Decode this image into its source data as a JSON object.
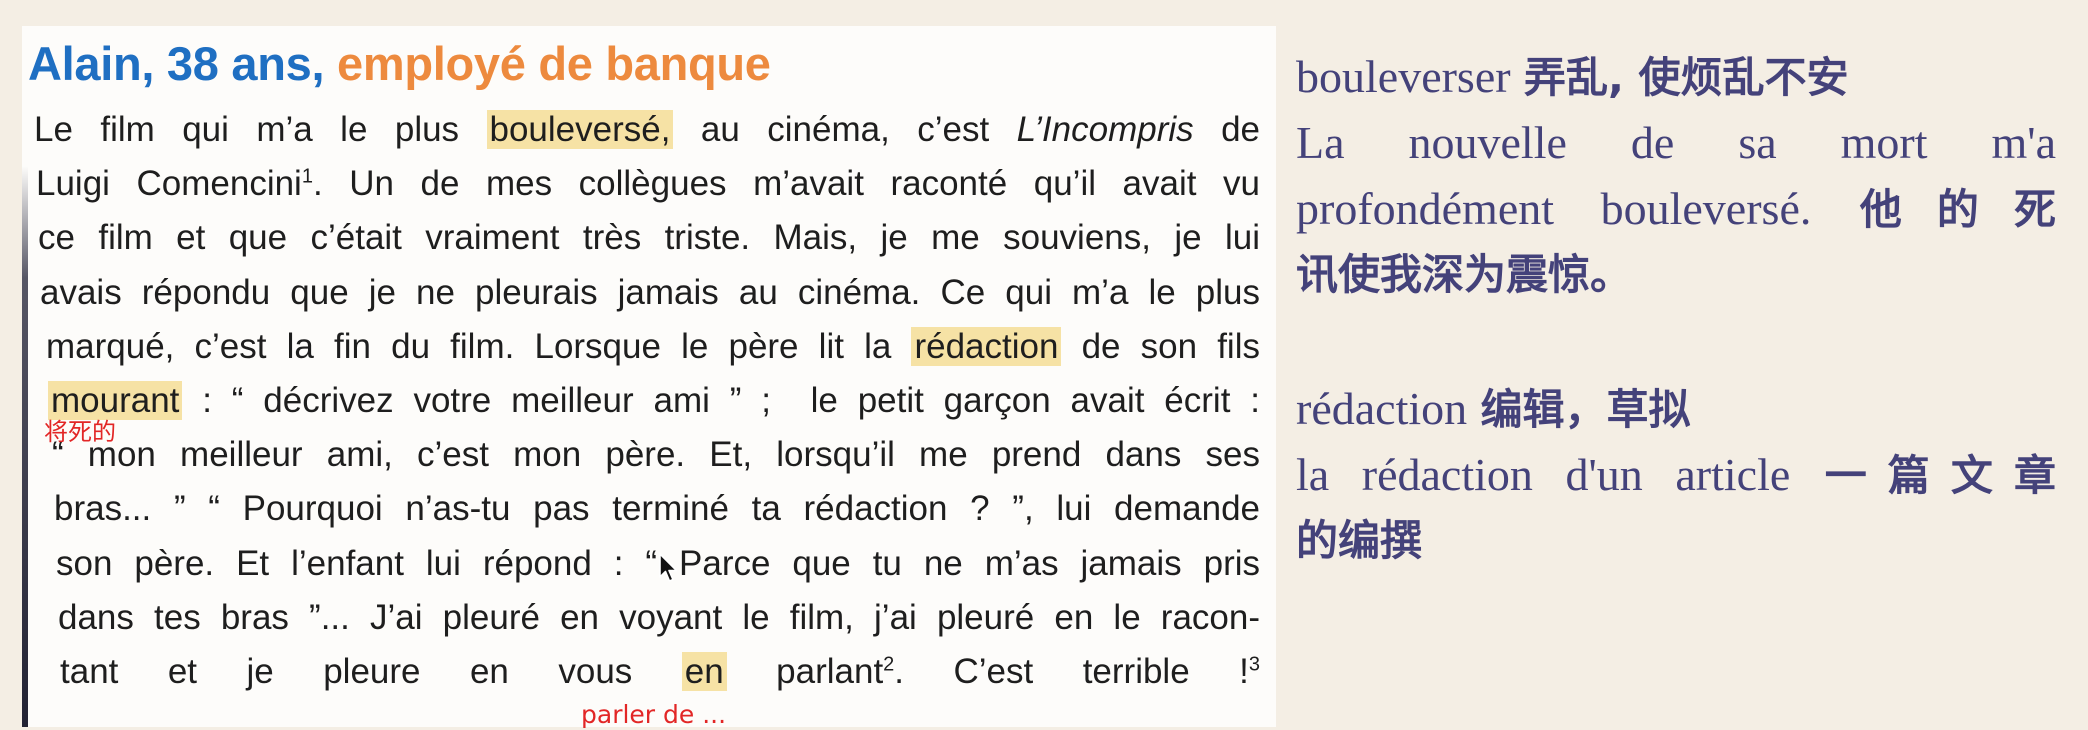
{
  "document": {
    "heading": {
      "name": "Alain, 38 ans,",
      "job": "employé de banque"
    },
    "paragraph_lines": [
      {
        "segments": [
          {
            "text": "Le film qui m’a le plus "
          },
          {
            "text": "bouleversé,",
            "highlight": true
          },
          {
            "text": " au cinéma, c’est "
          },
          {
            "text": "L’Incompris",
            "italic": true
          },
          {
            "text": " de"
          }
        ]
      },
      {
        "segments": [
          {
            "text": "Luigi Comencini"
          },
          {
            "text": "1",
            "sup": true
          },
          {
            "text": ". Un de mes collègues m’avait raconté qu’il avait vu"
          }
        ]
      },
      {
        "segments": [
          {
            "text": "ce film et que c’était vraiment très triste. Mais, je me souviens, je lui"
          }
        ]
      },
      {
        "segments": [
          {
            "text": "avais répondu que je ne pleurais jamais au cinéma. Ce qui m’a le plus"
          }
        ]
      },
      {
        "segments": [
          {
            "text": "marqué, c’est la fin du film. Lorsque le père lit la "
          },
          {
            "text": "rédaction",
            "highlight": true
          },
          {
            "text": " de son fils"
          }
        ]
      },
      {
        "segments": [
          {
            "text": "mourant",
            "highlight": true
          },
          {
            "text": " : “ décrivez votre meilleur ami ” ;  le petit garçon avait écrit :"
          }
        ]
      },
      {
        "segments": [
          {
            "text": "“ mon meilleur ami, c’est mon père. Et, lorsqu’il me prend dans ses"
          }
        ]
      },
      {
        "segments": [
          {
            "text": "bras... ” “ Pourquoi n’as-tu pas terminé ta rédaction ? ”, lui demande"
          }
        ]
      },
      {
        "segments": [
          {
            "text": "son père. Et l’enfant lui répond : “ Parce que tu ne m’as jamais pris"
          }
        ]
      },
      {
        "segments": [
          {
            "text": "dans tes bras ”... J’ai pleuré en voyant le film, j’ai pleuré en le racon-"
          }
        ]
      },
      {
        "segments": [
          {
            "text": "tant et je pleure en vous "
          },
          {
            "text": "en",
            "highlight": true
          },
          {
            "text": " parlant"
          },
          {
            "text": "2",
            "sup": true
          },
          {
            "text": ". C’est terrible !"
          },
          {
            "text": "3",
            "sup": true
          }
        ]
      }
    ],
    "annotations": {
      "mourant_note": "将死的",
      "en_note": "parler de ..."
    }
  },
  "notes": {
    "bouleverser": {
      "word": "bouleverser",
      "meaning": "弄乱, 使烦乱不安"
    },
    "example1": {
      "line1": "La nouvelle de sa mort m'a",
      "line2_fr": "profondément bouleversé.",
      "line2_zh": "他的死",
      "line3_zh": "讯使我深为震惊。"
    },
    "redaction": {
      "word": "rédaction",
      "meaning": "编辑，草拟"
    },
    "example2": {
      "line1_fr": "la rédaction d'un article",
      "line1_zh": "一篇文章",
      "line2_zh": "的编撰"
    }
  },
  "colors": {
    "page_background": "#f4eee4",
    "heading_name": "#1f6fc2",
    "heading_job": "#ed8a3e",
    "highlight": "#f6e2a5",
    "annotation": "#e22626",
    "notes_text": "#44427a"
  },
  "icons": {
    "cursor": "mouse-pointer-icon"
  }
}
